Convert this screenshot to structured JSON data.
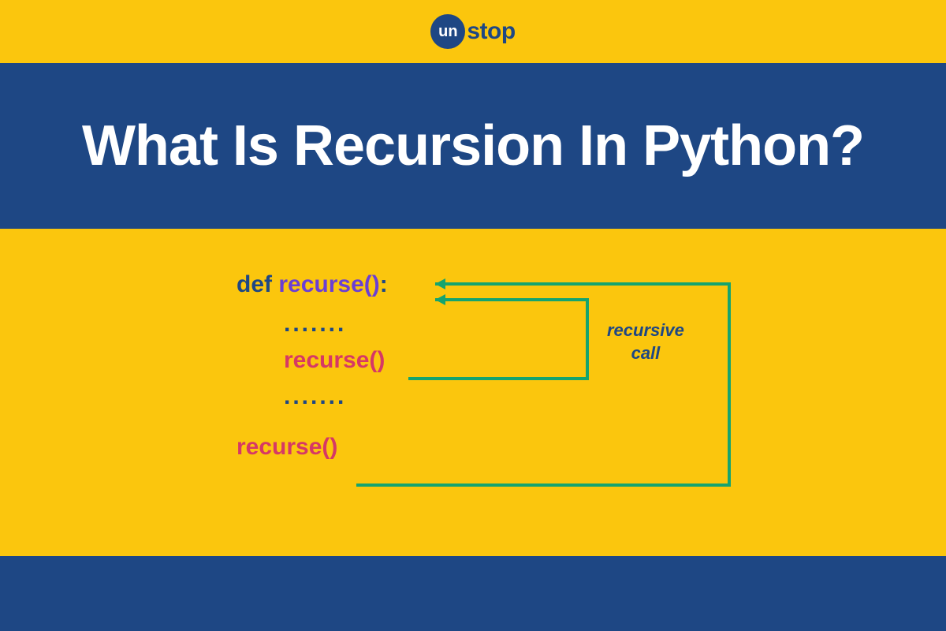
{
  "logo": {
    "circle_text": "un",
    "text": "stop"
  },
  "title": "What Is Recursion In Python?",
  "code": {
    "def_keyword": "def",
    "function_name": "recurse",
    "parens": "()",
    "colon": ":",
    "ellipsis1": ".......",
    "inner_call": "recurse()",
    "ellipsis2": ".......",
    "outer_call": "recurse()"
  },
  "annotation": {
    "line1": "recursive",
    "line2": "call"
  },
  "colors": {
    "yellow": "#fbc60d",
    "navy": "#1e4784",
    "purple": "#6b3fd4",
    "pink": "#d63865",
    "green": "#15a46e"
  }
}
